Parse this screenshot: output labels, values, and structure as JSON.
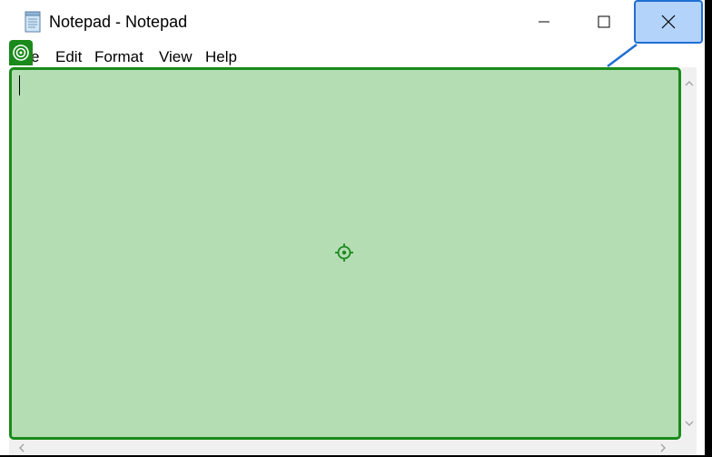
{
  "window": {
    "title": "Notepad - Notepad"
  },
  "menubar": {
    "items": [
      "e",
      "Edit",
      "Format",
      "View",
      "Help"
    ]
  },
  "editor": {
    "content": ""
  },
  "icons": {
    "app": "notepad-icon",
    "minimize": "minimize-icon",
    "maximize": "maximize-icon",
    "close": "close-icon",
    "target_badge": "target-icon",
    "crosshair": "crosshair-icon"
  },
  "colors": {
    "highlight_fill": "#b4ddb4",
    "highlight_border": "#1a8a1a",
    "close_fill": "#b3d3fb",
    "close_border": "#1f6fd3"
  }
}
